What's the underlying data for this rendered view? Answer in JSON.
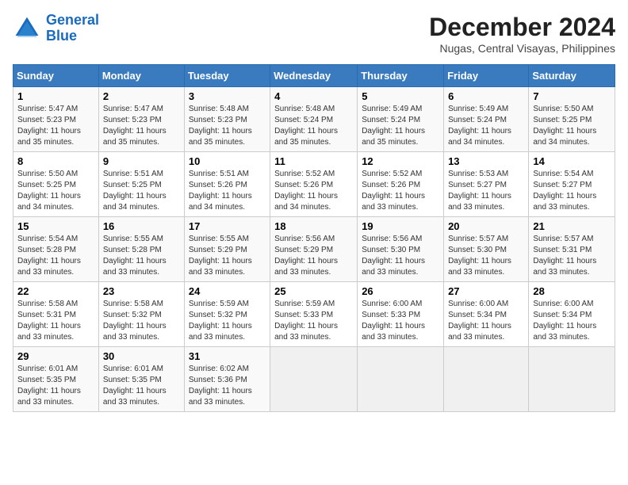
{
  "header": {
    "logo_line1": "General",
    "logo_line2": "Blue",
    "month": "December 2024",
    "location": "Nugas, Central Visayas, Philippines"
  },
  "weekdays": [
    "Sunday",
    "Monday",
    "Tuesday",
    "Wednesday",
    "Thursday",
    "Friday",
    "Saturday"
  ],
  "weeks": [
    [
      {
        "day": "1",
        "info": "Sunrise: 5:47 AM\nSunset: 5:23 PM\nDaylight: 11 hours\nand 35 minutes."
      },
      {
        "day": "2",
        "info": "Sunrise: 5:47 AM\nSunset: 5:23 PM\nDaylight: 11 hours\nand 35 minutes."
      },
      {
        "day": "3",
        "info": "Sunrise: 5:48 AM\nSunset: 5:23 PM\nDaylight: 11 hours\nand 35 minutes."
      },
      {
        "day": "4",
        "info": "Sunrise: 5:48 AM\nSunset: 5:24 PM\nDaylight: 11 hours\nand 35 minutes."
      },
      {
        "day": "5",
        "info": "Sunrise: 5:49 AM\nSunset: 5:24 PM\nDaylight: 11 hours\nand 35 minutes."
      },
      {
        "day": "6",
        "info": "Sunrise: 5:49 AM\nSunset: 5:24 PM\nDaylight: 11 hours\nand 34 minutes."
      },
      {
        "day": "7",
        "info": "Sunrise: 5:50 AM\nSunset: 5:25 PM\nDaylight: 11 hours\nand 34 minutes."
      }
    ],
    [
      {
        "day": "8",
        "info": "Sunrise: 5:50 AM\nSunset: 5:25 PM\nDaylight: 11 hours\nand 34 minutes."
      },
      {
        "day": "9",
        "info": "Sunrise: 5:51 AM\nSunset: 5:25 PM\nDaylight: 11 hours\nand 34 minutes."
      },
      {
        "day": "10",
        "info": "Sunrise: 5:51 AM\nSunset: 5:26 PM\nDaylight: 11 hours\nand 34 minutes."
      },
      {
        "day": "11",
        "info": "Sunrise: 5:52 AM\nSunset: 5:26 PM\nDaylight: 11 hours\nand 34 minutes."
      },
      {
        "day": "12",
        "info": "Sunrise: 5:52 AM\nSunset: 5:26 PM\nDaylight: 11 hours\nand 33 minutes."
      },
      {
        "day": "13",
        "info": "Sunrise: 5:53 AM\nSunset: 5:27 PM\nDaylight: 11 hours\nand 33 minutes."
      },
      {
        "day": "14",
        "info": "Sunrise: 5:54 AM\nSunset: 5:27 PM\nDaylight: 11 hours\nand 33 minutes."
      }
    ],
    [
      {
        "day": "15",
        "info": "Sunrise: 5:54 AM\nSunset: 5:28 PM\nDaylight: 11 hours\nand 33 minutes."
      },
      {
        "day": "16",
        "info": "Sunrise: 5:55 AM\nSunset: 5:28 PM\nDaylight: 11 hours\nand 33 minutes."
      },
      {
        "day": "17",
        "info": "Sunrise: 5:55 AM\nSunset: 5:29 PM\nDaylight: 11 hours\nand 33 minutes."
      },
      {
        "day": "18",
        "info": "Sunrise: 5:56 AM\nSunset: 5:29 PM\nDaylight: 11 hours\nand 33 minutes."
      },
      {
        "day": "19",
        "info": "Sunrise: 5:56 AM\nSunset: 5:30 PM\nDaylight: 11 hours\nand 33 minutes."
      },
      {
        "day": "20",
        "info": "Sunrise: 5:57 AM\nSunset: 5:30 PM\nDaylight: 11 hours\nand 33 minutes."
      },
      {
        "day": "21",
        "info": "Sunrise: 5:57 AM\nSunset: 5:31 PM\nDaylight: 11 hours\nand 33 minutes."
      }
    ],
    [
      {
        "day": "22",
        "info": "Sunrise: 5:58 AM\nSunset: 5:31 PM\nDaylight: 11 hours\nand 33 minutes."
      },
      {
        "day": "23",
        "info": "Sunrise: 5:58 AM\nSunset: 5:32 PM\nDaylight: 11 hours\nand 33 minutes."
      },
      {
        "day": "24",
        "info": "Sunrise: 5:59 AM\nSunset: 5:32 PM\nDaylight: 11 hours\nand 33 minutes."
      },
      {
        "day": "25",
        "info": "Sunrise: 5:59 AM\nSunset: 5:33 PM\nDaylight: 11 hours\nand 33 minutes."
      },
      {
        "day": "26",
        "info": "Sunrise: 6:00 AM\nSunset: 5:33 PM\nDaylight: 11 hours\nand 33 minutes."
      },
      {
        "day": "27",
        "info": "Sunrise: 6:00 AM\nSunset: 5:34 PM\nDaylight: 11 hours\nand 33 minutes."
      },
      {
        "day": "28",
        "info": "Sunrise: 6:00 AM\nSunset: 5:34 PM\nDaylight: 11 hours\nand 33 minutes."
      }
    ],
    [
      {
        "day": "29",
        "info": "Sunrise: 6:01 AM\nSunset: 5:35 PM\nDaylight: 11 hours\nand 33 minutes."
      },
      {
        "day": "30",
        "info": "Sunrise: 6:01 AM\nSunset: 5:35 PM\nDaylight: 11 hours\nand 33 minutes."
      },
      {
        "day": "31",
        "info": "Sunrise: 6:02 AM\nSunset: 5:36 PM\nDaylight: 11 hours\nand 33 minutes."
      },
      {
        "day": "",
        "info": ""
      },
      {
        "day": "",
        "info": ""
      },
      {
        "day": "",
        "info": ""
      },
      {
        "day": "",
        "info": ""
      }
    ]
  ]
}
